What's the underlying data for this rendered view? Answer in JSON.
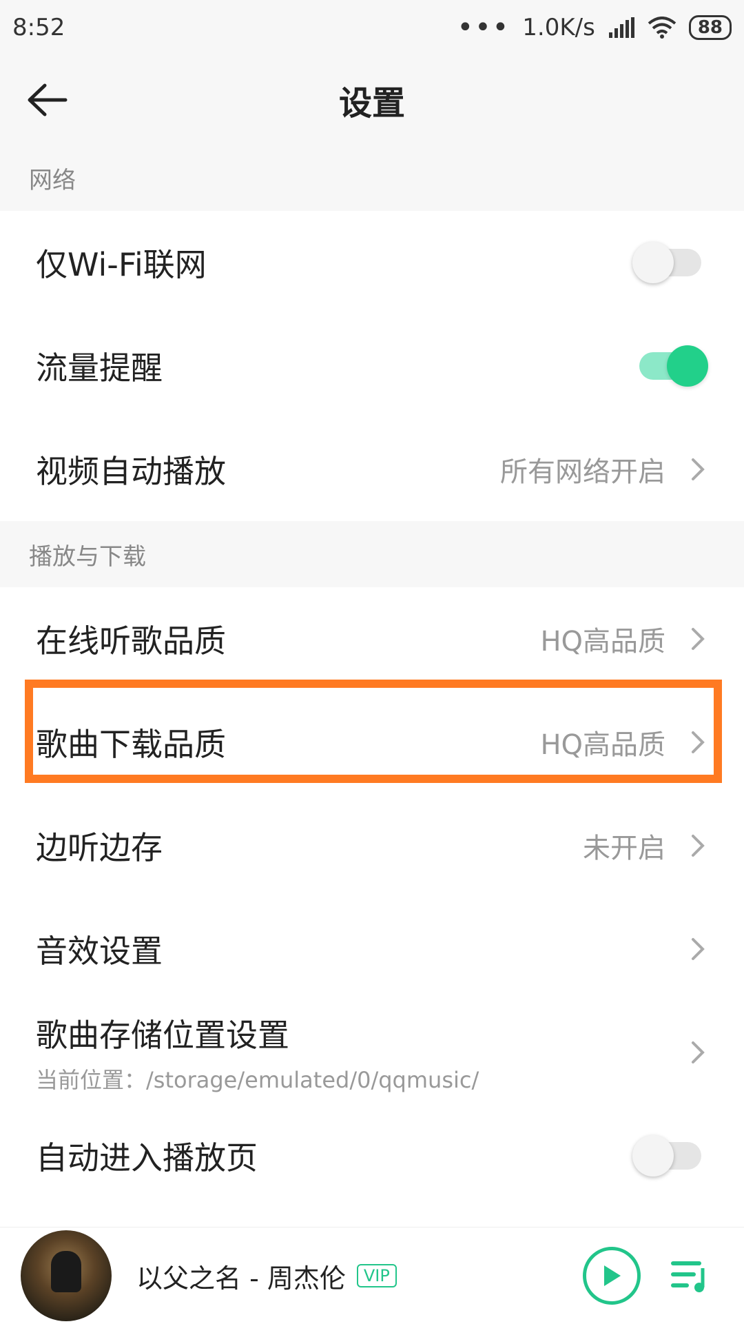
{
  "status_bar": {
    "time": "8:52",
    "dots": "•••",
    "speed": "1.0K/s",
    "battery": "88"
  },
  "header": {
    "title": "设置"
  },
  "sections": {
    "network": {
      "title": "网络",
      "wifi_only": {
        "label": "仅Wi-Fi联网",
        "enabled": false
      },
      "data_alert": {
        "label": "流量提醒",
        "enabled": true
      },
      "video_autoplay": {
        "label": "视频自动播放",
        "value": "所有网络开启"
      }
    },
    "playback": {
      "title": "播放与下载",
      "online_quality": {
        "label": "在线听歌品质",
        "value": "HQ高品质"
      },
      "download_quality": {
        "label": "歌曲下载品质",
        "value": "HQ高品质"
      },
      "cache_while_play": {
        "label": "边听边存",
        "value": "未开启"
      },
      "sound_effect": {
        "label": "音效设置"
      },
      "storage_location": {
        "label": "歌曲存储位置设置",
        "sub": "当前位置：/storage/emulated/0/qqmusic/"
      },
      "auto_player_page": {
        "label": "自动进入播放页",
        "enabled": false
      }
    }
  },
  "player": {
    "song": "以父之名 - 周杰伦",
    "vip": "VIP"
  },
  "colors": {
    "accent_green": "#22d08a",
    "highlight_orange": "#ff7a22"
  }
}
